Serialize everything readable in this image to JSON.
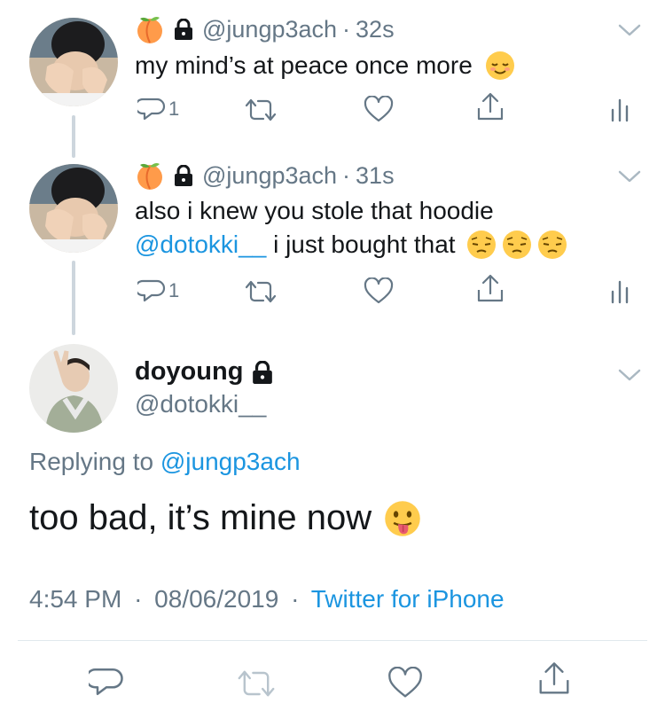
{
  "tweets": [
    {
      "handle": "@jungp3ach",
      "separator": "·",
      "time": "32s",
      "text": "my mind’s at peace once more",
      "reply_count": "1"
    },
    {
      "handle": "@jungp3ach",
      "separator": "·",
      "time": "31s",
      "text_line1": "also i knew you stole that hoodie",
      "mention": "@dotokki__",
      "text_line2": " i just bought that",
      "reply_count": "1"
    }
  ],
  "main_tweet": {
    "display_name": "doyoung",
    "handle": "@dotokki__",
    "replying_prefix": "Replying to ",
    "replying_handle": "@jungp3ach",
    "text": "too bad, it’s mine now",
    "time": "4:54 PM",
    "date": "08/06/2019",
    "separator": "·",
    "source": "Twitter for iPhone"
  },
  "colors": {
    "link": "#1b95e0",
    "secondary": "#657786",
    "primary_text": "#14171a",
    "thread_line": "#cdd6dd"
  },
  "icons": [
    "peach-emoji",
    "lock-icon",
    "chevron-down-icon",
    "reply-icon",
    "retweet-icon",
    "like-icon",
    "share-icon",
    "analytics-icon",
    "relieved-emoji",
    "pensive-emoji",
    "tongue-emoji"
  ]
}
